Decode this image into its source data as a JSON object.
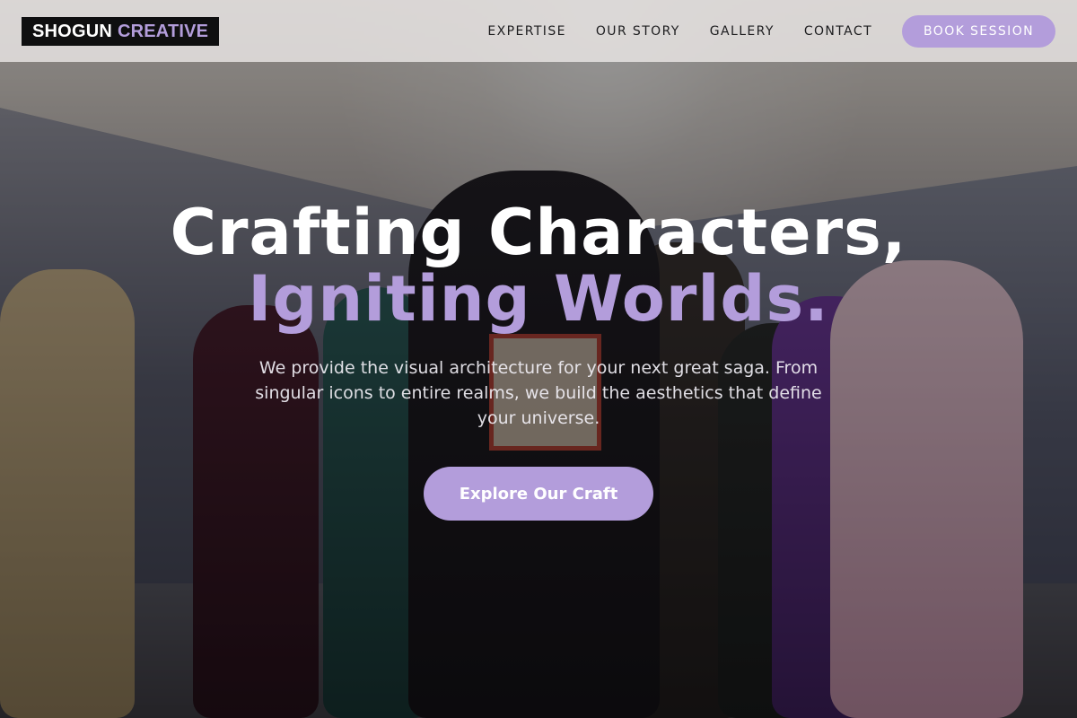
{
  "brand": {
    "name": "SHOGUN",
    "accent": "CREATIVE",
    "accent_color": "#b39ddb"
  },
  "nav": {
    "links": [
      "EXPERTISE",
      "OUR STORY",
      "GALLERY",
      "CONTACT"
    ],
    "cta": "BOOK SESSION"
  },
  "hero": {
    "title_line1": "Crafting Characters,",
    "title_line2": "Igniting Worlds.",
    "subtitle": "We provide the visual architecture for your next great saga. From singular icons to entire realms, we build the aesthetics that define your universe.",
    "cta": "Explore Our Craft"
  },
  "colors": {
    "accent": "#b39ddb",
    "nav_bg": "#ece9e7",
    "logo_bg": "#0f0f10"
  }
}
